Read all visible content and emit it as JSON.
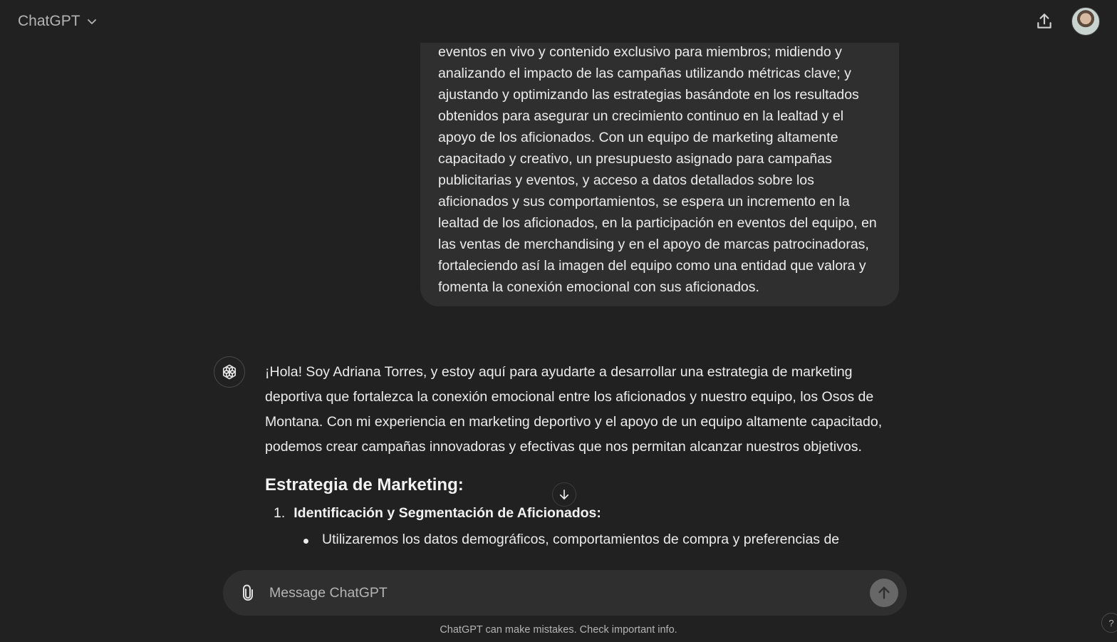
{
  "header": {
    "model_name": "ChatGPT"
  },
  "user_message": {
    "text": "eventos en vivo y contenido exclusivo para miembros; midiendo y analizando el impacto de las campañas utilizando métricas clave; y ajustando y optimizando las estrategias basándote en los resultados obtenidos para asegurar un crecimiento continuo en la lealtad y el apoyo de los aficionados. Con un equipo de marketing altamente capacitado y creativo, un presupuesto asignado para campañas publicitarias y eventos, y acceso a datos detallados sobre los aficionados y sus comportamientos, se espera un incremento en la lealtad de los aficionados, en la participación en eventos del equipo, en las ventas de merchandising y en el apoyo de marcas patrocinadoras, fortaleciendo así la imagen del equipo como una entidad que valora y fomenta la conexión emocional con sus aficionados."
  },
  "assistant_message": {
    "intro": "¡Hola! Soy Adriana Torres, y estoy aquí para ayudarte a desarrollar una estrategia de marketing deportiva que fortalezca la conexión emocional entre los aficionados y nuestro equipo, los Osos de Montana. Con mi experiencia en marketing deportivo y el apoyo de un equipo altamente capacitado, podemos crear campañas innovadoras y efectivas que nos permitan alcanzar nuestros objetivos.",
    "heading": "Estrategia de Marketing:",
    "list_items": [
      {
        "number": "1.",
        "title": "Identificación y Segmentación de Aficionados:",
        "bullets": [
          "Utilizaremos los datos demográficos, comportamientos de compra y preferencias de"
        ]
      }
    ]
  },
  "composer": {
    "placeholder": "Message ChatGPT"
  },
  "footer": {
    "disclaimer": "ChatGPT can make mistakes. Check important info.",
    "help_label": "?"
  },
  "icons": {
    "header_chevron": "chevron-down-icon",
    "share": "share-upload-icon",
    "assistant": "openai-logo-icon",
    "scroll": "arrow-down-icon",
    "attach": "paperclip-icon",
    "send": "arrow-up-icon"
  },
  "colors": {
    "background": "#212121",
    "bubble": "#2f2f2f",
    "send_button": "#676767",
    "text": "#ececec",
    "muted_text": "#b4b4b4"
  }
}
